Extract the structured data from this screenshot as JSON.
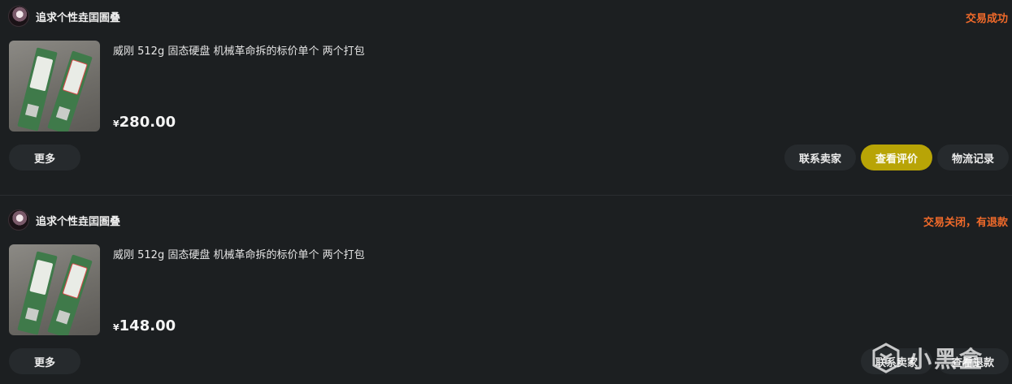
{
  "orders": [
    {
      "seller": "追求个性垚囯圄叠",
      "status": "交易成功",
      "title": "威刚 512g 固态硬盘 机械革命拆的标价单个 两个打包",
      "currency": "¥",
      "price": "280.00",
      "actions": {
        "more": "更多",
        "contact": "联系卖家",
        "review": "查看评价",
        "logistics": "物流记录"
      }
    },
    {
      "seller": "追求个性垚囯圄叠",
      "status": "交易关闭，有退款",
      "title": "威刚 512g 固态硬盘 机械革命拆的标价单个 两个打包",
      "currency": "¥",
      "price": "148.00",
      "actions": {
        "more": "更多",
        "contact": "联系卖家",
        "refund": "查看退款"
      }
    }
  ],
  "watermark": {
    "text": "小黑盒",
    "icon": "xiaoheihe-logo-icon"
  },
  "colors": {
    "background": "#1c1f21",
    "status": "#f06a2a",
    "accent_button": "#b8a406",
    "button": "#262a2d"
  }
}
